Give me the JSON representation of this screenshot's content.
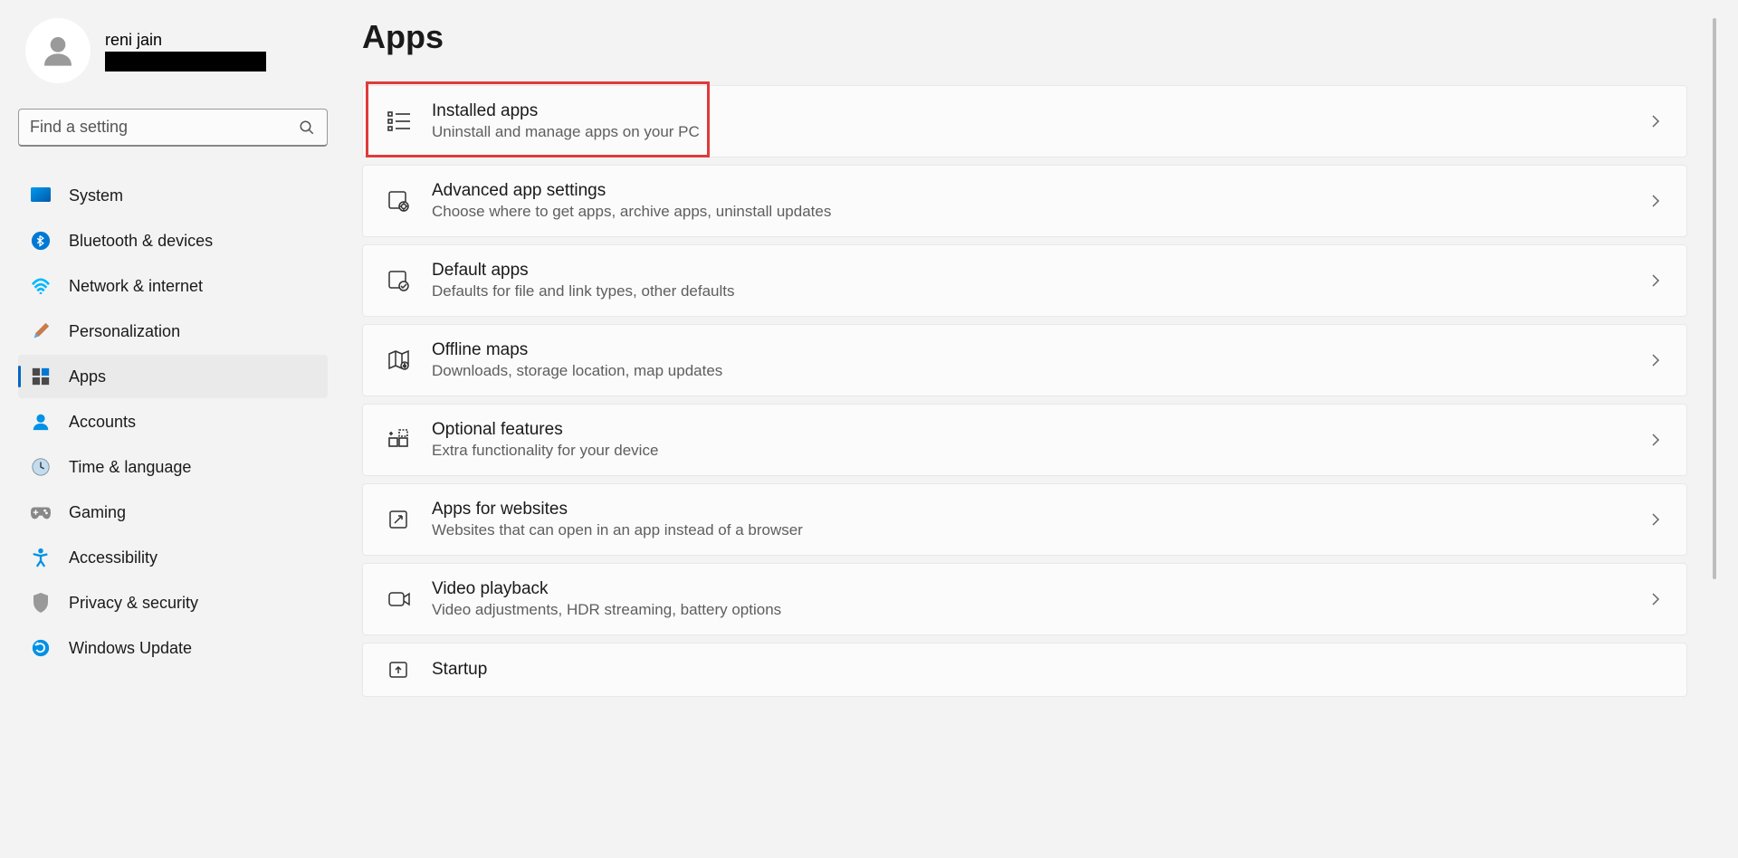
{
  "profile": {
    "name": "reni jain"
  },
  "search": {
    "placeholder": "Find a setting"
  },
  "sidebar": {
    "items": [
      {
        "label": "System",
        "icon": "system"
      },
      {
        "label": "Bluetooth & devices",
        "icon": "bluetooth"
      },
      {
        "label": "Network & internet",
        "icon": "network"
      },
      {
        "label": "Personalization",
        "icon": "personalization"
      },
      {
        "label": "Apps",
        "icon": "apps"
      },
      {
        "label": "Accounts",
        "icon": "accounts"
      },
      {
        "label": "Time & language",
        "icon": "time"
      },
      {
        "label": "Gaming",
        "icon": "gaming"
      },
      {
        "label": "Accessibility",
        "icon": "accessibility"
      },
      {
        "label": "Privacy & security",
        "icon": "privacy"
      },
      {
        "label": "Windows Update",
        "icon": "update"
      }
    ]
  },
  "page": {
    "title": "Apps"
  },
  "cards": [
    {
      "title": "Installed apps",
      "subtitle": "Uninstall and manage apps on your PC",
      "icon": "installed-apps"
    },
    {
      "title": "Advanced app settings",
      "subtitle": "Choose where to get apps, archive apps, uninstall updates",
      "icon": "advanced-app"
    },
    {
      "title": "Default apps",
      "subtitle": "Defaults for file and link types, other defaults",
      "icon": "default-apps"
    },
    {
      "title": "Offline maps",
      "subtitle": "Downloads, storage location, map updates",
      "icon": "offline-maps"
    },
    {
      "title": "Optional features",
      "subtitle": "Extra functionality for your device",
      "icon": "optional-features"
    },
    {
      "title": "Apps for websites",
      "subtitle": "Websites that can open in an app instead of a browser",
      "icon": "apps-websites"
    },
    {
      "title": "Video playback",
      "subtitle": "Video adjustments, HDR streaming, battery options",
      "icon": "video-playback"
    },
    {
      "title": "Startup",
      "subtitle": "",
      "icon": "startup"
    }
  ]
}
